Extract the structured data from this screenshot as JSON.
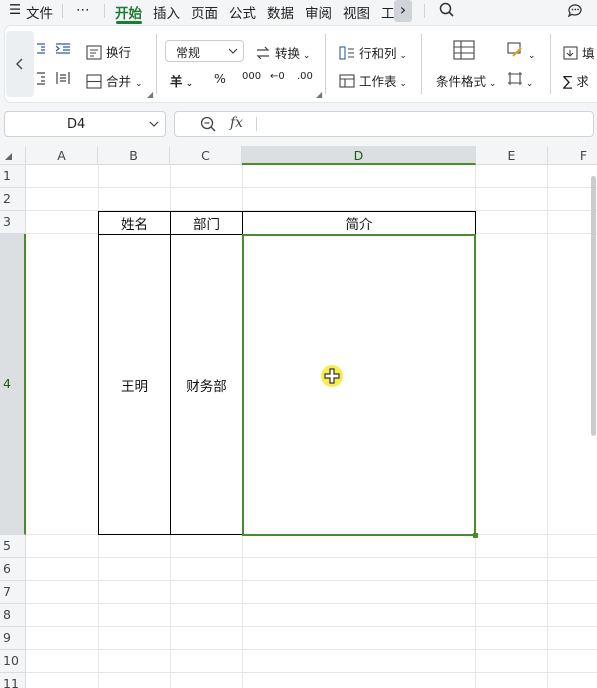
{
  "menubar": {
    "hamburger": "☰",
    "file_label": "文件",
    "more_label": "⋯",
    "tabs": [
      "开始",
      "插入",
      "页面",
      "公式",
      "数据",
      "审阅",
      "视图",
      "工"
    ],
    "active_tab": "开始",
    "more_arrow": "›"
  },
  "ribbon": {
    "wrap_label": "换行",
    "merge_label": "合并",
    "number_format": "常规",
    "convert_label": "转换",
    "rowcol_label": "行和列",
    "worksheet_label": "工作表",
    "cond_format_label": "条件格式",
    "fill_label": "填",
    "sum_label": "求",
    "currency_symbol": "羊",
    "percent_symbol": "%",
    "thousands_symbol": "000",
    "dec_inc_symbol": "←0",
    "dec_dec_symbol": ".00"
  },
  "formula_bar": {
    "name_box_value": "D4",
    "fx_label": "fx",
    "formula_value": ""
  },
  "sheet": {
    "columns": [
      "A",
      "B",
      "C",
      "D",
      "E",
      "F"
    ],
    "selected_column": "D",
    "rows": [
      "1",
      "2",
      "3",
      "4",
      "5",
      "6",
      "7",
      "8",
      "9",
      "10",
      "11"
    ],
    "selected_row": "4",
    "table": {
      "headers": [
        "姓名",
        "部门",
        "简介"
      ],
      "row": [
        "王明",
        "财务部",
        ""
      ]
    },
    "active_cell": "D4"
  },
  "colors": {
    "accent": "#1e7b35",
    "selection": "#4c8b2b",
    "cursor_halo": "#f5ea3a"
  }
}
